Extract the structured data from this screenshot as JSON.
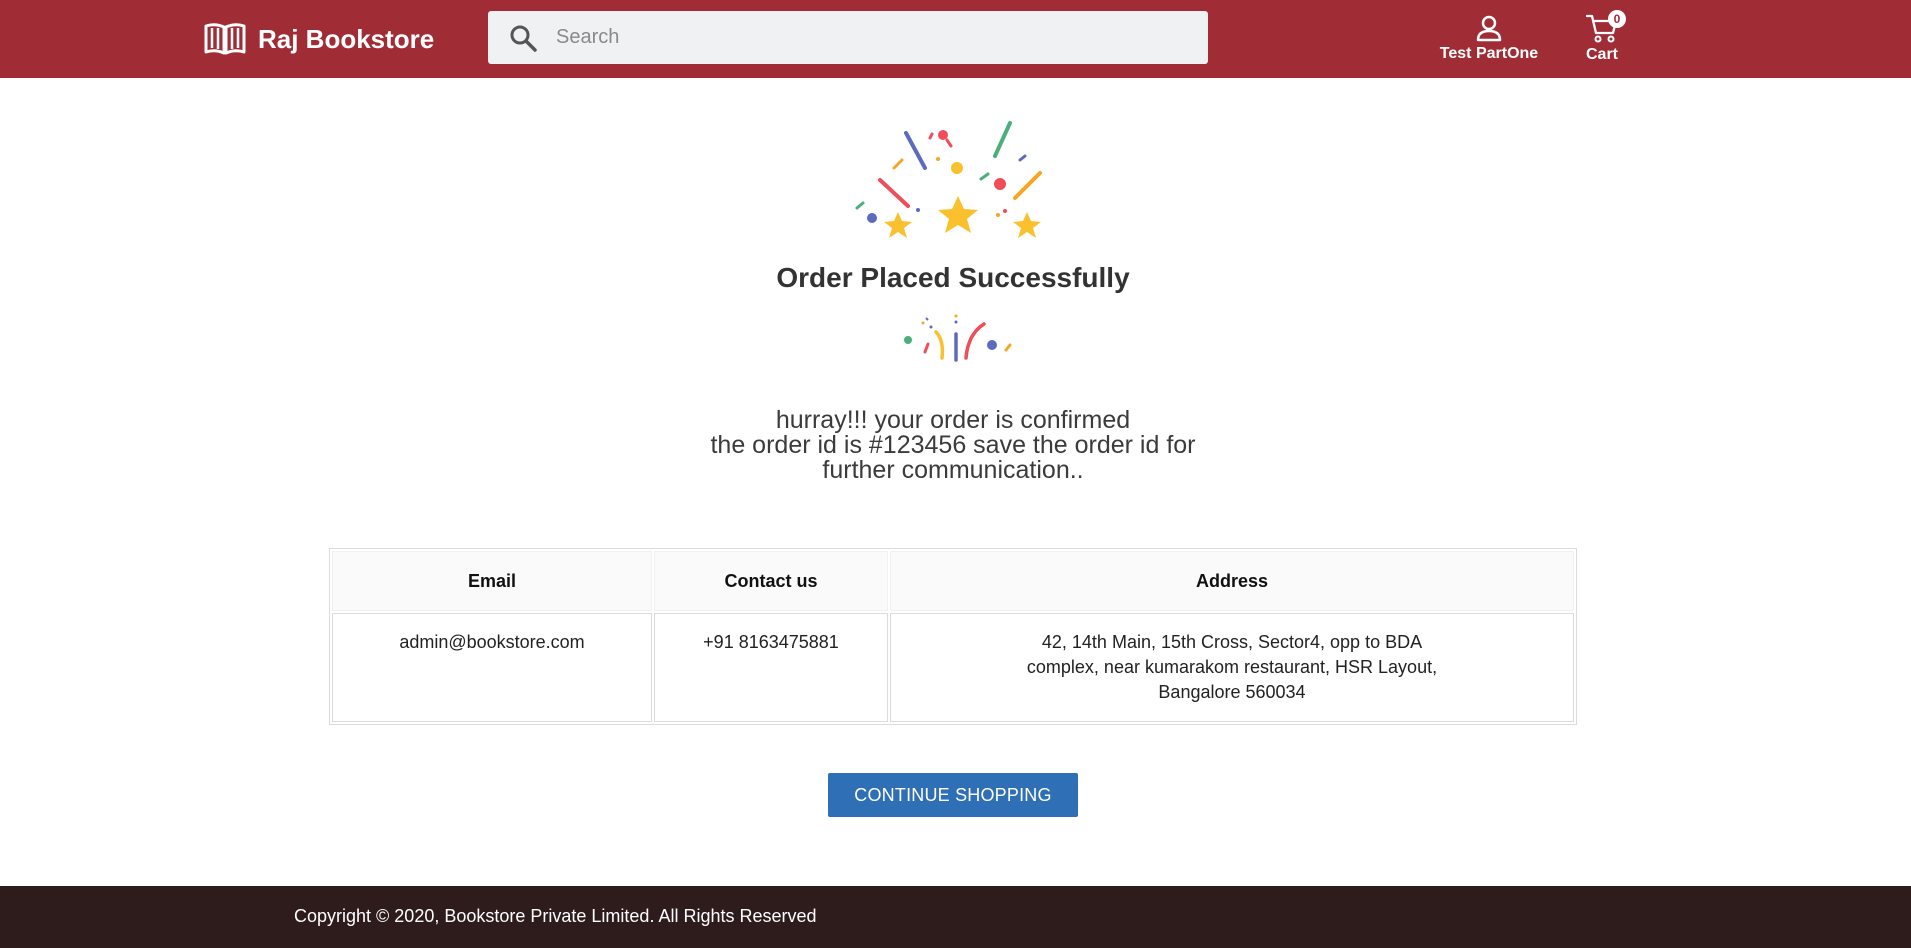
{
  "header": {
    "brand": "Raj Bookstore",
    "logo_icon": "open-book-icon",
    "search_placeholder": "Search",
    "search_icon": "search-icon",
    "user_label": "Test PartOne",
    "user_icon": "person-icon",
    "cart_label": "Cart",
    "cart_count": "0",
    "cart_icon": "cart-icon",
    "color": "#a02c35"
  },
  "main": {
    "title": "Order Placed Successfully",
    "message_lines": [
      "hurray!!! your order is confirmed",
      "the order id is #123456 save the order id for",
      "further communication.."
    ],
    "table": {
      "headers": [
        "Email",
        "Contact us",
        "Address"
      ],
      "email": "admin@bookstore.com",
      "phone": "+91 8163475881",
      "address_lines": [
        "42, 14th Main, 15th Cross, Sector4, opp to BDA",
        "complex, near kumarakom restaurant, HSR Layout,",
        "Bangalore 560034"
      ]
    },
    "continue_label": "CONTINUE SHOPPING",
    "button_color": "#2f6fb5"
  },
  "footer": {
    "copyright": "Copyright © 2020, Bookstore Private Limited. All Rights Reserved",
    "color": "#2e1c1c"
  }
}
